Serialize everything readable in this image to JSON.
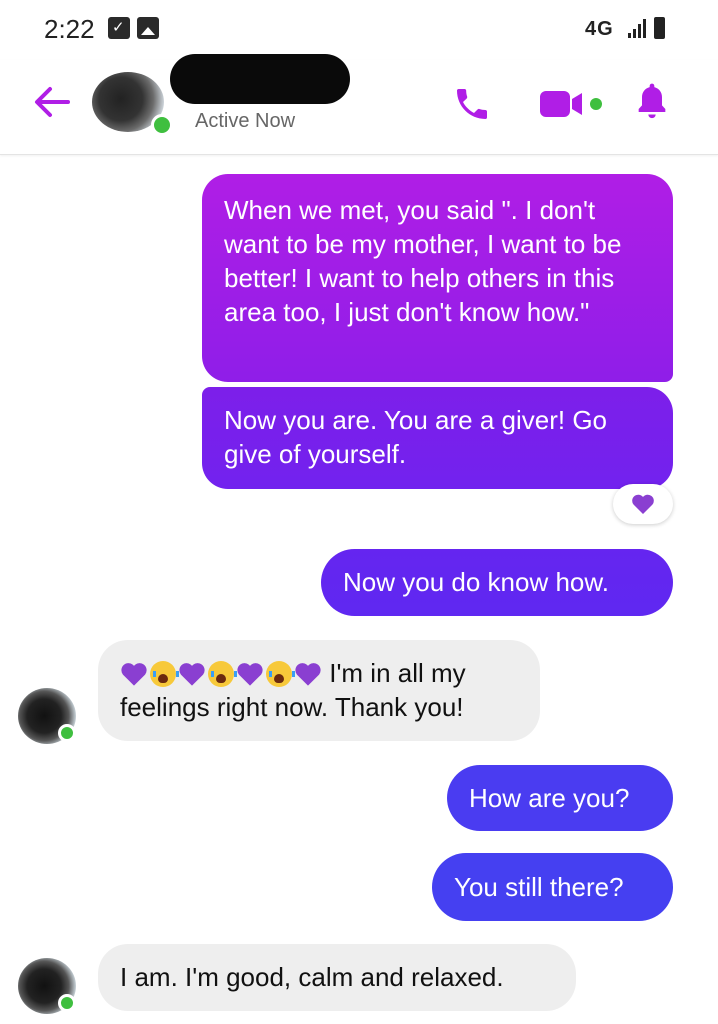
{
  "status_bar": {
    "time": "2:22",
    "network": "4G",
    "icons": [
      "calendar-notification-icon",
      "gallery-notification-icon",
      "signal-bars-icon",
      "battery-icon"
    ]
  },
  "header": {
    "contact_status": "Active Now",
    "icons": [
      "back-arrow-icon",
      "phone-call-icon",
      "video-call-icon",
      "bell-icon"
    ],
    "accent_color": "#b01ee6"
  },
  "messages": [
    {
      "direction": "sent",
      "text": "When we met, you said \". I don't want to be my mother, I want to be better! I want to help others in this area too, I just don't know how.\""
    },
    {
      "direction": "sent",
      "text": "Now you are.  You are a giver! Go give of yourself.",
      "reaction": "purple-heart"
    },
    {
      "direction": "sent",
      "text": "Now you do know how."
    },
    {
      "direction": "received",
      "emoji_prefix": [
        "purple-heart",
        "crying-face",
        "purple-heart",
        "crying-face",
        "purple-heart",
        "crying-face",
        "purple-heart"
      ],
      "text": "I'm in all my feelings right now. Thank you!"
    },
    {
      "direction": "sent",
      "text": "How are you?"
    },
    {
      "direction": "sent",
      "text": "You still there?"
    },
    {
      "direction": "received",
      "text": "I am. I'm good, calm and relaxed."
    }
  ],
  "colors": {
    "sent_top": "#b01ee6",
    "sent_bottom": "#4540f1",
    "received_bg": "#eeeeee",
    "online": "#3fbf3f"
  }
}
